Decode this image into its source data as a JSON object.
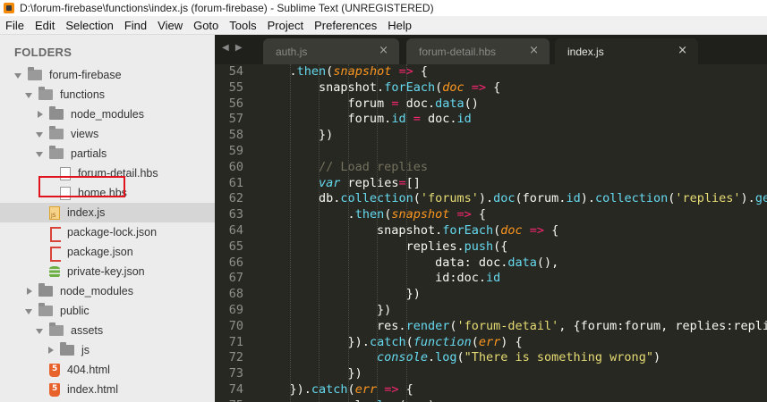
{
  "window": {
    "title": "D:\\forum-firebase\\functions\\index.js (forum-firebase) - Sublime Text (UNREGISTERED)"
  },
  "menu": [
    "File",
    "Edit",
    "Selection",
    "Find",
    "View",
    "Goto",
    "Tools",
    "Project",
    "Preferences",
    "Help"
  ],
  "sidebar": {
    "header": "FOLDERS",
    "tree": [
      {
        "label": "forum-firebase",
        "kind": "folder",
        "open": true,
        "depth": 0
      },
      {
        "label": "functions",
        "kind": "folder",
        "open": true,
        "depth": 1
      },
      {
        "label": "node_modules",
        "kind": "folder",
        "open": false,
        "depth": 2
      },
      {
        "label": "views",
        "kind": "folder",
        "open": true,
        "depth": 2,
        "noArrowIcon": true
      },
      {
        "label": "partials",
        "kind": "folder",
        "open": true,
        "depth": 2,
        "highlighted": true
      },
      {
        "label": "forum-detail.hbs",
        "kind": "file",
        "icon": "file",
        "depth": 3
      },
      {
        "label": "home.hbs",
        "kind": "file",
        "icon": "file",
        "depth": 3
      },
      {
        "label": "index.js",
        "kind": "file",
        "icon": "js",
        "depth": 2,
        "selected": true
      },
      {
        "label": "package-lock.json",
        "kind": "file",
        "icon": "json",
        "depth": 2
      },
      {
        "label": "package.json",
        "kind": "file",
        "icon": "json",
        "depth": 2
      },
      {
        "label": "private-key.json",
        "kind": "file",
        "icon": "db",
        "depth": 2
      },
      {
        "label": "node_modules",
        "kind": "folder",
        "open": false,
        "depth": 1
      },
      {
        "label": "public",
        "kind": "folder",
        "open": true,
        "depth": 1
      },
      {
        "label": "assets",
        "kind": "folder",
        "open": true,
        "depth": 2
      },
      {
        "label": "js",
        "kind": "folder",
        "open": false,
        "depth": 3
      },
      {
        "label": "404.html",
        "kind": "file",
        "icon": "html",
        "depth": 2
      },
      {
        "label": "index.html",
        "kind": "file",
        "icon": "html",
        "depth": 2
      }
    ]
  },
  "tabs": [
    {
      "label": "auth.js",
      "active": false
    },
    {
      "label": "forum-detail.hbs",
      "active": false
    },
    {
      "label": "index.js",
      "active": true
    }
  ],
  "tab_close_glyph": "×",
  "tab_nav_glyph": "◀ ▶",
  "colors": {
    "keyword": "#f92672",
    "function": "#66d9ef",
    "param": "#fd971f",
    "string": "#e6db74",
    "comment": "#75715e",
    "text": "#f8f8f2",
    "editor_bg": "#272822"
  },
  "code": [
    {
      "n": "54",
      "indent": 4,
      "tokens": [
        [
          ".",
          ""
        ],
        [
          "then",
          "fn"
        ],
        [
          "(",
          ""
        ],
        [
          "snapshot",
          "param"
        ],
        [
          " ",
          ""
        ],
        [
          "=>",
          "kw"
        ],
        [
          " {",
          ""
        ]
      ]
    },
    {
      "n": "55",
      "indent": 8,
      "tokens": [
        [
          "snapshot.",
          ""
        ],
        [
          "forEach",
          "fn"
        ],
        [
          "(",
          ""
        ],
        [
          "doc",
          "param"
        ],
        [
          " ",
          ""
        ],
        [
          "=>",
          "kw"
        ],
        [
          " {",
          ""
        ]
      ]
    },
    {
      "n": "56",
      "indent": 12,
      "tokens": [
        [
          "forum ",
          ""
        ],
        [
          "=",
          "kw"
        ],
        [
          " doc.",
          ""
        ],
        [
          "data",
          "fn"
        ],
        [
          "()",
          ""
        ]
      ]
    },
    {
      "n": "57",
      "indent": 12,
      "tokens": [
        [
          "forum.",
          ""
        ],
        [
          "id",
          "fn"
        ],
        [
          " ",
          ""
        ],
        [
          "=",
          "kw"
        ],
        [
          " doc.",
          ""
        ],
        [
          "id",
          "fn"
        ]
      ]
    },
    {
      "n": "58",
      "indent": 8,
      "tokens": [
        [
          "})",
          ""
        ]
      ]
    },
    {
      "n": "59",
      "indent": 0,
      "tokens": []
    },
    {
      "n": "60",
      "indent": 8,
      "tokens": [
        [
          "// Load replies",
          "cmt"
        ]
      ]
    },
    {
      "n": "61",
      "indent": 8,
      "tokens": [
        [
          "var",
          "var"
        ],
        [
          " replies",
          ""
        ],
        [
          "=",
          "kw"
        ],
        [
          "[]",
          ""
        ]
      ]
    },
    {
      "n": "62",
      "indent": 8,
      "tokens": [
        [
          "db.",
          ""
        ],
        [
          "collection",
          "fn"
        ],
        [
          "(",
          ""
        ],
        [
          "'forums'",
          "str"
        ],
        [
          ").",
          ""
        ],
        [
          "doc",
          "fn"
        ],
        [
          "(forum.",
          ""
        ],
        [
          "id",
          "fn"
        ],
        [
          ").",
          ""
        ],
        [
          "collection",
          "fn"
        ],
        [
          "(",
          ""
        ],
        [
          "'replies'",
          "str"
        ],
        [
          ").",
          ""
        ],
        [
          "get",
          "fn"
        ]
      ]
    },
    {
      "n": "63",
      "indent": 12,
      "tokens": [
        [
          ".",
          ""
        ],
        [
          "then",
          "fn"
        ],
        [
          "(",
          ""
        ],
        [
          "snapshot",
          "param"
        ],
        [
          " ",
          ""
        ],
        [
          "=>",
          "kw"
        ],
        [
          " {",
          ""
        ]
      ]
    },
    {
      "n": "64",
      "indent": 16,
      "tokens": [
        [
          "snapshot.",
          ""
        ],
        [
          "forEach",
          "fn"
        ],
        [
          "(",
          ""
        ],
        [
          "doc",
          "param"
        ],
        [
          " ",
          ""
        ],
        [
          "=>",
          "kw"
        ],
        [
          " {",
          ""
        ]
      ]
    },
    {
      "n": "65",
      "indent": 20,
      "tokens": [
        [
          "replies.",
          ""
        ],
        [
          "push",
          "fn"
        ],
        [
          "({",
          ""
        ]
      ]
    },
    {
      "n": "66",
      "indent": 24,
      "tokens": [
        [
          "data: doc.",
          ""
        ],
        [
          "data",
          "fn"
        ],
        [
          "(),",
          ""
        ]
      ]
    },
    {
      "n": "67",
      "indent": 24,
      "tokens": [
        [
          "id:doc.",
          ""
        ],
        [
          "id",
          "fn"
        ]
      ]
    },
    {
      "n": "68",
      "indent": 20,
      "tokens": [
        [
          "})",
          ""
        ]
      ]
    },
    {
      "n": "69",
      "indent": 16,
      "tokens": [
        [
          "})",
          ""
        ]
      ]
    },
    {
      "n": "70",
      "indent": 16,
      "tokens": [
        [
          "res.",
          ""
        ],
        [
          "render",
          "fn"
        ],
        [
          "(",
          ""
        ],
        [
          "'forum-detail'",
          "str"
        ],
        [
          ", {forum:forum, replies:replies})",
          ""
        ]
      ]
    },
    {
      "n": "71",
      "indent": 12,
      "tokens": [
        [
          "}).",
          ""
        ],
        [
          "catch",
          "fn"
        ],
        [
          "(",
          ""
        ],
        [
          "function",
          "var"
        ],
        [
          "(",
          ""
        ],
        [
          "err",
          "param"
        ],
        [
          ") {",
          ""
        ]
      ]
    },
    {
      "n": "72",
      "indent": 16,
      "tokens": [
        [
          "console",
          "cls"
        ],
        [
          ".",
          ""
        ],
        [
          "log",
          "fn"
        ],
        [
          "(",
          ""
        ],
        [
          "\"There is something wrong\"",
          "str"
        ],
        [
          ")",
          ""
        ]
      ]
    },
    {
      "n": "73",
      "indent": 12,
      "tokens": [
        [
          "})",
          ""
        ]
      ]
    },
    {
      "n": "74",
      "indent": 4,
      "tokens": [
        [
          "}).",
          ""
        ],
        [
          "catch",
          "fn"
        ],
        [
          "(",
          ""
        ],
        [
          "err",
          "param"
        ],
        [
          " ",
          ""
        ],
        [
          "=>",
          "kw"
        ],
        [
          " {",
          ""
        ]
      ]
    },
    {
      "n": "75",
      "indent": 8,
      "tokens": [
        [
          "console.",
          ""
        ],
        [
          "log",
          "fn"
        ],
        [
          "(err)",
          ""
        ]
      ]
    }
  ]
}
